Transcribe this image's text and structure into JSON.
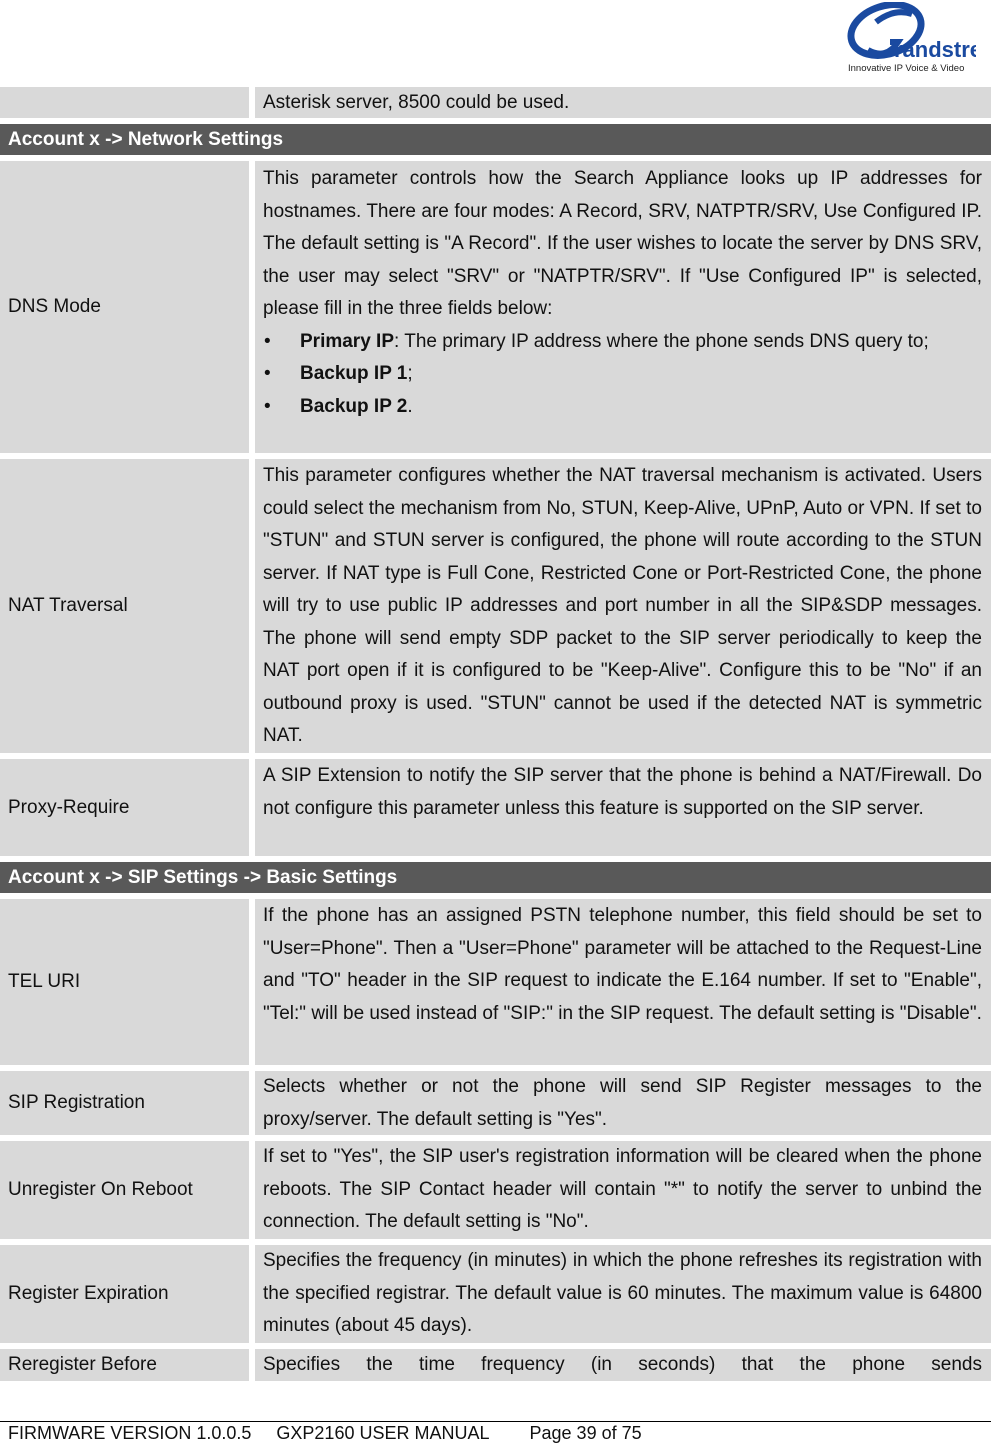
{
  "header": {
    "logo": {
      "brand": "randstream",
      "brand_initial": "G",
      "tagline": "Innovative IP Voice & Video",
      "color": "#1a4aa0"
    }
  },
  "table": {
    "continuation_row": {
      "name": "",
      "description": "Asterisk server, 8500 could be used."
    },
    "sections": [
      {
        "title": "Account x -> Network Settings",
        "rows": [
          {
            "name": "DNS Mode",
            "description": "This parameter controls how the Search Appliance looks up IP addresses for hostnames. There are four modes: A Record, SRV, NATPTR/SRV, Use Configured IP. The default setting is \"A Record\". If the user wishes to locate the server by DNS SRV, the user may select \"SRV\" or \"NATPTR/SRV\". If \"Use Configured IP\" is selected, please fill in the three fields below:",
            "bullets": [
              {
                "bold": "Primary IP",
                "text": ": The primary IP address where the phone sends DNS query to;"
              },
              {
                "bold": "Backup IP 1",
                "text": ";"
              },
              {
                "bold": "Backup IP 2",
                "text": "."
              }
            ]
          },
          {
            "name": "NAT Traversal",
            "description": "This parameter configures whether the NAT traversal mechanism is activated. Users could select the mechanism from No, STUN, Keep-Alive, UPnP, Auto or VPN. If set to \"STUN\" and STUN server is configured, the phone will route according to the STUN server. If NAT type is Full Cone, Restricted Cone or Port-Restricted Cone, the phone will try to use public IP addresses and port number in all the SIP&SDP messages. The phone will send empty SDP packet to the SIP server periodically to keep the NAT port open if it is configured to be \"Keep-Alive\". Configure this to be \"No\" if an outbound proxy is used. \"STUN\" cannot be used if the detected NAT is symmetric NAT."
          },
          {
            "name": "Proxy-Require",
            "description": "A SIP Extension to notify the SIP server that the phone is behind a NAT/Firewall. Do not configure this parameter unless this feature is supported on the SIP server."
          }
        ]
      },
      {
        "title": "Account x -> SIP Settings -> Basic Settings",
        "rows": [
          {
            "name": "TEL URI",
            "description": "If the phone has an assigned PSTN telephone number, this field should be set to \"User=Phone\". Then a \"User=Phone\" parameter will be attached to the Request-Line and \"TO\" header in the SIP request to indicate the E.164 number. If set to \"Enable\", \"Tel:\" will be used instead of \"SIP:\" in the SIP request. The default setting is \"Disable\"."
          },
          {
            "name": "SIP Registration",
            "description": "Selects whether or not the phone will send SIP Register messages to the proxy/server. The default setting is \"Yes\"."
          },
          {
            "name": "Unregister On Reboot",
            "description": "If set to \"Yes\", the SIP user's registration information will be cleared when the phone reboots. The SIP Contact header will contain \"*\" to notify the server to unbind the connection. The default setting is \"No\"."
          },
          {
            "name": "Register Expiration",
            "description": "Specifies the frequency (in minutes) in which the phone refreshes its registration with the specified registrar. The default value is 60 minutes. The maximum value is 64800 minutes (about 45 days)."
          },
          {
            "name": "Reregister Before",
            "description": "Specifies the time frequency (in seconds) that the phone sends"
          }
        ]
      }
    ]
  },
  "footer": {
    "firmware": "FIRMWARE VERSION 1.0.0.5",
    "manual": "GXP2160 USER MANUAL",
    "page": "Page 39 of 75"
  }
}
